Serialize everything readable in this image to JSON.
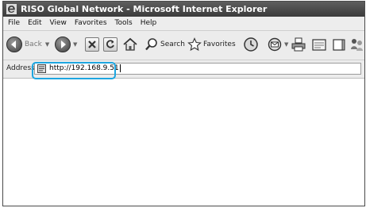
{
  "window": {
    "title": "RISO Global Network - Microsoft Internet Explorer"
  },
  "menu": {
    "items": [
      "File",
      "Edit",
      "View",
      "Favorites",
      "Tools",
      "Help"
    ]
  },
  "toolbar": {
    "back_label": "Back",
    "search_label": "Search",
    "favorites_label": "Favorites",
    "icons": [
      "back-icon",
      "forward-icon",
      "stop-icon",
      "refresh-icon",
      "home-icon",
      "search-icon",
      "favorites-star-icon",
      "history-icon",
      "mail-icon",
      "print-icon",
      "edit-icon",
      "discuss-icon",
      "messenger-icon"
    ]
  },
  "address": {
    "label": "Address",
    "value": "http://192.168.9.51"
  },
  "colors": {
    "highlight": "#1ea6e0",
    "titlebar": "#4a4a4a"
  }
}
